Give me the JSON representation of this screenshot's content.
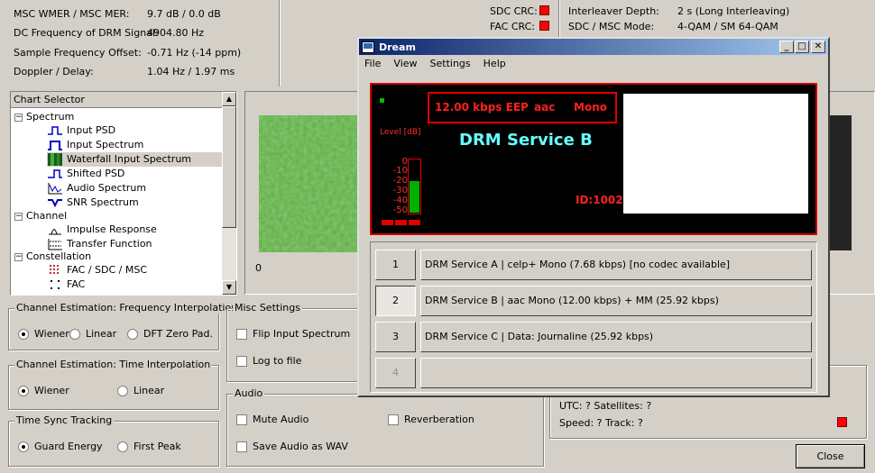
{
  "status": {
    "rows": [
      {
        "label": "MSC WMER / MSC MER:",
        "value": "9.7 dB / 0.0 dB"
      },
      {
        "label": "DC Frequency of DRM Signal:",
        "value": "4904.80 Hz"
      },
      {
        "label": "Sample Frequency Offset:",
        "value": "-0.71 Hz (-14 ppm)"
      },
      {
        "label": "Doppler / Delay:",
        "value": "1.04 Hz / 1.97 ms"
      }
    ],
    "crc": [
      {
        "label": "SDC CRC:"
      },
      {
        "label": "FAC CRC:"
      }
    ],
    "info": [
      {
        "label": "Interleaver Depth:",
        "value": "2 s (Long Interleaving)"
      },
      {
        "label": "SDC / MSC Mode:",
        "value": "4-QAM / SM 64-QAM"
      }
    ],
    "partial_value": "5",
    "led_color": "#ff0000"
  },
  "chart_selector": {
    "header": "Chart Selector",
    "items": [
      {
        "label": "Spectrum",
        "expander": "−",
        "icon": ""
      },
      {
        "label": "Input PSD",
        "icon": "psd-icon"
      },
      {
        "label": "Input Spectrum",
        "icon": "spectrum-icon"
      },
      {
        "label": "Waterfall Input Spectrum",
        "icon": "waterfall-icon",
        "selected": true
      },
      {
        "label": "Shifted PSD",
        "icon": "psd-icon"
      },
      {
        "label": "Audio Spectrum",
        "icon": "audio-spectrum-icon"
      },
      {
        "label": "SNR Spectrum",
        "icon": "snr-icon"
      },
      {
        "label": "Channel",
        "expander": "−",
        "icon": ""
      },
      {
        "label": "Impulse Response",
        "icon": "impulse-icon"
      },
      {
        "label": "Transfer Function",
        "icon": "transfer-icon"
      },
      {
        "label": "Constellation",
        "expander": "−",
        "icon": ""
      },
      {
        "label": "FAC / SDC / MSC",
        "icon": "constellation-icon"
      },
      {
        "label": "FAC",
        "icon": "constellation-icon"
      }
    ]
  },
  "chart": {
    "x_tick": "0"
  },
  "freq_interp": {
    "title": "Channel Estimation: Frequency Interpolation",
    "options": [
      "Wiener",
      "Linear",
      "DFT Zero Pad."
    ],
    "selected": "Wiener"
  },
  "time_interp": {
    "title": "Channel Estimation: Time Interpolation",
    "options": [
      "Wiener",
      "Linear"
    ],
    "selected": "Wiener"
  },
  "time_sync": {
    "title": "Time Sync Tracking",
    "options": [
      "Guard Energy",
      "First Peak"
    ],
    "selected": "Guard Energy"
  },
  "misc": {
    "title": "Misc Settings",
    "flip": "Flip Input Spectrum",
    "log": "Log to file"
  },
  "audio": {
    "title": "Audio",
    "mute": "Mute Audio",
    "reverb": "Reverberation",
    "save_wav": "Save Audio as WAV"
  },
  "gps": {
    "line1": "UTC: ?   Satellites: ?",
    "speed": "Speed: ?  Track: ?"
  },
  "close_button": "Close",
  "dialog": {
    "title": "Dream",
    "menu": [
      "File",
      "View",
      "Settings",
      "Help"
    ],
    "display": {
      "bitrate": "12.00 kbps EEP",
      "codec": "aac",
      "mode": "Mono",
      "service_name": "DRM Service B",
      "id": "ID:1002",
      "level_label": "Level [dB]",
      "level_ticks": [
        "0",
        "-10",
        "-20",
        "-30",
        "-40",
        "-50"
      ],
      "level_value_db": -20,
      "level_min_db": -50,
      "level_max_db": 0
    },
    "services": [
      {
        "num": "1",
        "label": "DRM Service A  |   celp+ Mono (7.68 kbps) [no codec available]"
      },
      {
        "num": "2",
        "label": "DRM Service B  |   aac Mono (12.00 kbps) + MM (25.92 kbps)",
        "selected": true
      },
      {
        "num": "3",
        "label": "DRM Service C  |   Data: Journaline (25.92 kbps)"
      },
      {
        "num": "4",
        "label": "",
        "disabled": true
      }
    ]
  }
}
